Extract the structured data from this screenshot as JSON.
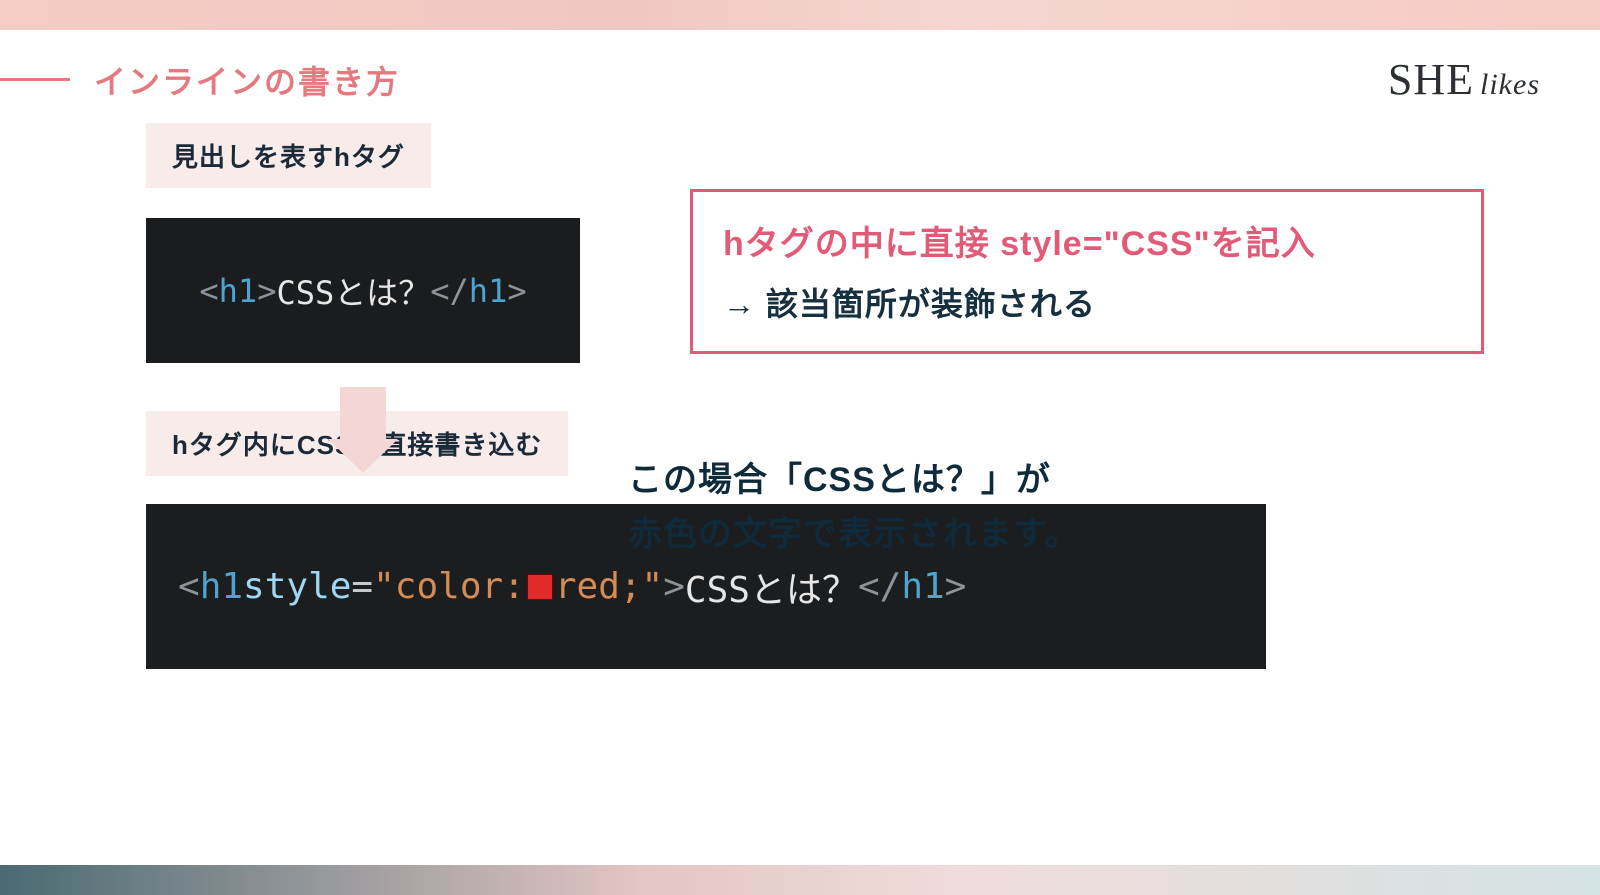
{
  "header": {
    "title": "インラインの書き方",
    "brand_main": "SHE",
    "brand_sub": "likes"
  },
  "badges": {
    "heading_tag": "見出しを表すhタグ",
    "inline_css": "hタグ内にCSSを直接書き込む"
  },
  "code1": {
    "open_bracket": "<",
    "tag_open": "h1",
    "gt": ">",
    "text": "CSSとは？",
    "close_open": "</",
    "tag_close": "h1",
    "close_gt": ">"
  },
  "callout": {
    "line1": "hタグの中に直接 style=\"CSS\"を記入",
    "line2": "→ 該当箇所が装飾される"
  },
  "explain": {
    "line1": "この場合「CSSとは？」が",
    "line2": "赤色の文字で表示されます。"
  },
  "code2": {
    "open_bracket": "<",
    "tag_open": "h1",
    "space": " ",
    "attr": "style",
    "eq": "=",
    "q1": "\"",
    "prop": "color:",
    "val": "red;",
    "q2": "\"",
    "gt": ">",
    "text": "CSSとは？",
    "close_open": "</",
    "tag_close": "h1",
    "close_gt": ">"
  }
}
